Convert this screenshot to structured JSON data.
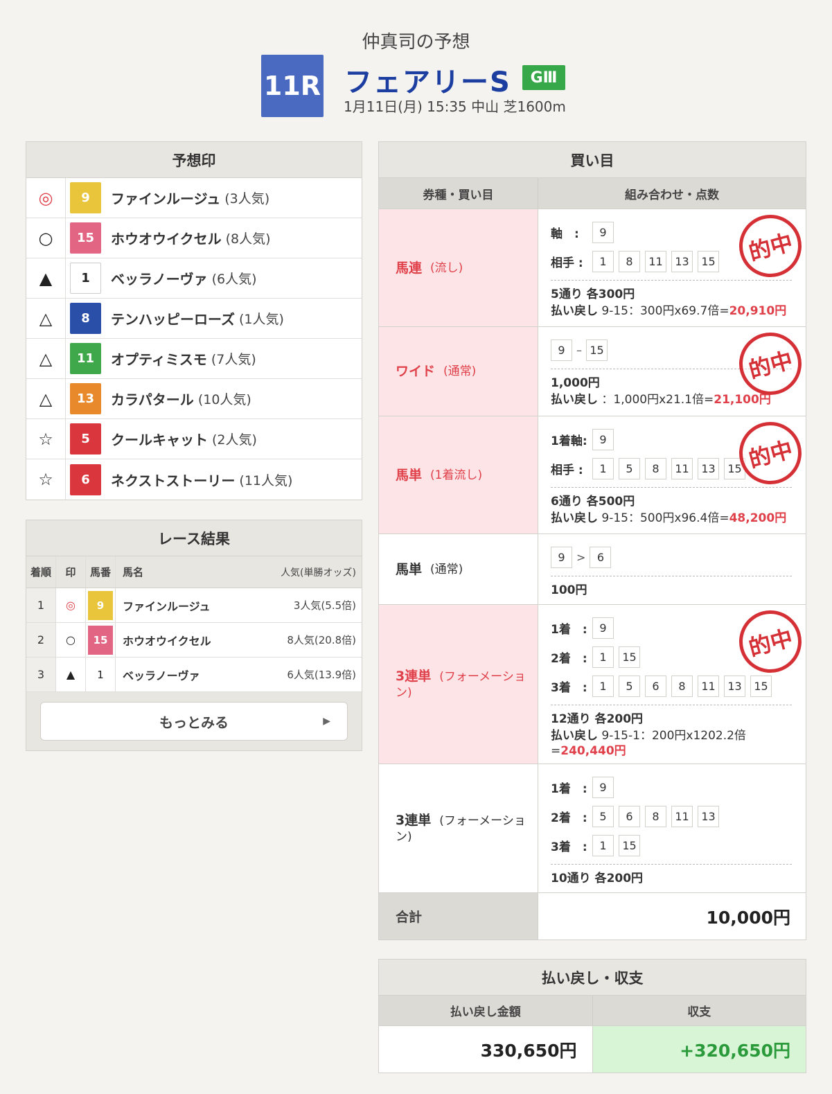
{
  "header": {
    "forecaster": "仲真司の予想",
    "race_number": "11R",
    "race_name": "フェアリーS",
    "grade": "GⅢ",
    "race_info": "1月11日(月) 15:35 中山 芝1600m"
  },
  "prediction": {
    "title": "予想印",
    "rows": [
      {
        "mark": "◎",
        "num": "9",
        "color": "#e8c53a",
        "name": "ファインルージュ",
        "pop": "(3人気)"
      },
      {
        "mark": "○",
        "num": "15",
        "color": "#e26583",
        "name": "ホウオウイクセル",
        "pop": "(8人気)"
      },
      {
        "mark": "▲",
        "num": "1",
        "color": "#ffffff",
        "name": "ベッラノーヴァ",
        "pop": "(6人気)"
      },
      {
        "mark": "△",
        "num": "8",
        "color": "#2a4fa8",
        "name": "テンハッピーローズ",
        "pop": "(1人気)"
      },
      {
        "mark": "△",
        "num": "11",
        "color": "#3ea84a",
        "name": "オプティミスモ",
        "pop": "(7人気)"
      },
      {
        "mark": "△",
        "num": "13",
        "color": "#e88a2c",
        "name": "カラパタール",
        "pop": "(10人気)"
      },
      {
        "mark": "☆",
        "num": "5",
        "color": "#d9373d",
        "name": "クールキャット",
        "pop": "(2人気)"
      },
      {
        "mark": "☆",
        "num": "6",
        "color": "#d9373d",
        "name": "ネクストストーリー",
        "pop": "(11人気)"
      }
    ]
  },
  "results": {
    "title": "レース結果",
    "headers": {
      "rank": "着順",
      "mark": "印",
      "num": "馬番",
      "name": "馬名",
      "pop": "人気(単勝オッズ)"
    },
    "rows": [
      {
        "rank": "1",
        "mark": "◎",
        "num": "9",
        "color": "#e8c53a",
        "name": "ファインルージュ",
        "pop": "3人気(5.5倍)"
      },
      {
        "rank": "2",
        "mark": "○",
        "num": "15",
        "color": "#e26583",
        "name": "ホウオウイクセル",
        "pop": "8人気(20.8倍)"
      },
      {
        "rank": "3",
        "mark": "▲",
        "num": "1",
        "color": "#ffffff",
        "name": "ベッラノーヴァ",
        "pop": "6人気(13.9倍)"
      }
    ],
    "more": "もっとみる"
  },
  "bets": {
    "title": "買い目",
    "col1": "券種・買い目",
    "col2": "組み合わせ・点数",
    "hit_stamp": "的中",
    "b1": {
      "type": "馬連",
      "sub": "(流し)",
      "axis_label": "軸　:",
      "axis": [
        "9"
      ],
      "partner_label": "相手 :",
      "partners": [
        "1",
        "8",
        "11",
        "13",
        "15"
      ],
      "count": "5通り 各300円",
      "pay_label": "払い戻し",
      "pay_text": "9-15：300円x69.7倍=",
      "pay_amt": "20,910円"
    },
    "b2": {
      "type": "ワイド",
      "sub": "(通常)",
      "left": "9",
      "sep": "–",
      "right": "15",
      "count": "1,000円",
      "pay_label": "払い戻し",
      "pay_text": "：1,000円x21.1倍=",
      "pay_amt": "21,100円"
    },
    "b3": {
      "type": "馬単",
      "sub": "(1着流し)",
      "axis_label": "1着軸:",
      "axis": [
        "9"
      ],
      "partner_label": "相手 :",
      "partners": [
        "1",
        "5",
        "8",
        "11",
        "13",
        "15"
      ],
      "count": "6通り 各500円",
      "pay_label": "払い戻し",
      "pay_text": "9-15：500円x96.4倍=",
      "pay_amt": "48,200円"
    },
    "b4": {
      "type": "馬単",
      "sub": "(通常)",
      "left": "9",
      "sep": ">",
      "right": "6",
      "count": "100円"
    },
    "b5": {
      "type": "3連単",
      "sub": "(フォーメーション)",
      "l1": "1着　:",
      "f1": [
        "9"
      ],
      "l2": "2着　:",
      "f2": [
        "1",
        "15"
      ],
      "l3": "3着　:",
      "f3": [
        "1",
        "5",
        "6",
        "8",
        "11",
        "13",
        "15"
      ],
      "count": "12通り 各200円",
      "pay_label": "払い戻し",
      "pay_text": "9-15-1：200円x1202.2倍=",
      "pay_amt": "240,440円"
    },
    "b6": {
      "type": "3連単",
      "sub": "(フォーメーション)",
      "l1": "1着　:",
      "f1": [
        "9"
      ],
      "l2": "2着　:",
      "f2": [
        "5",
        "6",
        "8",
        "11",
        "13"
      ],
      "l3": "3着　:",
      "f3": [
        "1",
        "15"
      ],
      "count": "10通り 各200円"
    },
    "total_label": "合計",
    "total": "10,000円"
  },
  "payout": {
    "title": "払い戻し・収支",
    "h1": "払い戻し金額",
    "h2": "収支",
    "v1": "330,650円",
    "v2": "+320,650円"
  }
}
